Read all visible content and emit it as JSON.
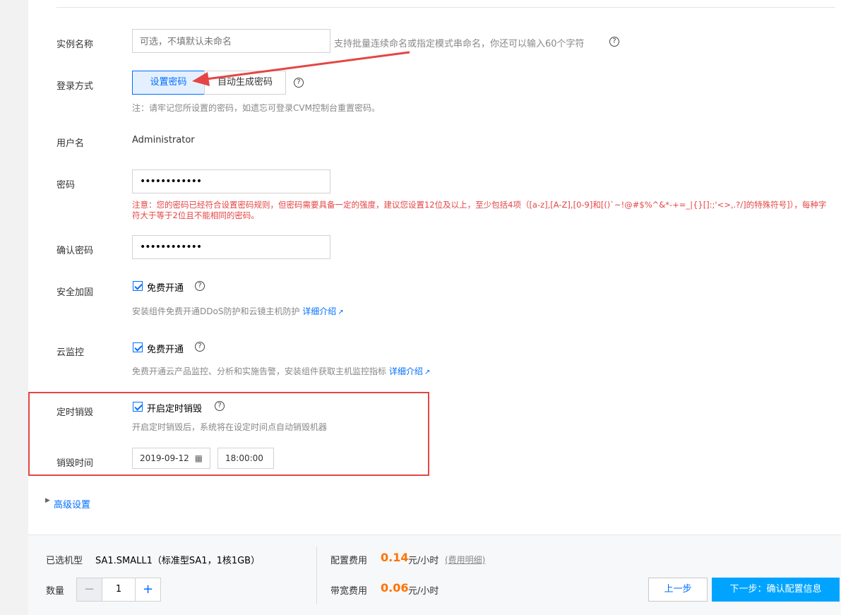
{
  "form": {
    "instance_name": {
      "label": "实例名称",
      "placeholder": "可选，不填默认未命名",
      "hint": "支持批量连续命名或指定模式串命名，你还可以输入60个字符"
    },
    "login": {
      "label": "登录方式",
      "option_set": "设置密码",
      "option_auto": "自动生成密码",
      "note": "注：请牢记您所设置的密码，如遗忘可登录CVM控制台重置密码。"
    },
    "username": {
      "label": "用户名",
      "value": "Administrator"
    },
    "password": {
      "label": "密码",
      "value": "••••••••••••",
      "warning": "注意：您的密码已经符合设置密码规则，但密码需要具备一定的强度，建议您设置12位及以上，至少包括4项（[a-z],[A-Z],[0-9]和[()`~!@#$%^&*-+=_|{}[]:;'<>,.?/]的特殊符号]），每种字符大于等于2位且不能相同的密码。"
    },
    "confirm_password": {
      "label": "确认密码",
      "value": "••••••••••••"
    },
    "security": {
      "label": "安全加固",
      "checkbox_label": "免费开通",
      "hint": "安装组件免费开通DDoS防护和云镜主机防护",
      "link": "详细介绍"
    },
    "monitor": {
      "label": "云监控",
      "checkbox_label": "免费开通",
      "hint": "免费开通云产品监控、分析和实施告警，安装组件获取主机监控指标",
      "link": "详细介绍"
    },
    "scheduled_destroy": {
      "label": "定时销毁",
      "checkbox_label": "开启定时销毁",
      "hint": "开启定时销毁后，系统将在设定时间点自动销毁机器"
    },
    "destroy_time": {
      "label": "销毁时间",
      "date": "2019-09-12",
      "time": "18:00:00"
    },
    "advanced": "高级设置"
  },
  "footer": {
    "model_label": "已选机型",
    "model_value": "SA1.SMALL1（标准型SA1，1核1GB）",
    "qty_label": "数量",
    "qty_value": "1",
    "config_fee_label": "配置费用",
    "config_fee_price": "0.14",
    "config_fee_unit": "元/小时",
    "fee_detail_link": "(费用明细)",
    "bandwidth_fee_label": "带宽费用",
    "bandwidth_fee_price": "0.06",
    "bandwidth_fee_unit": "元/小时",
    "prev_button": "上一步",
    "next_button": "下一步：确认配置信息"
  },
  "colors": {
    "accent": "#006eff",
    "warning": "#e54545",
    "price": "#ff7200",
    "primary_button": "#00a4ff"
  }
}
